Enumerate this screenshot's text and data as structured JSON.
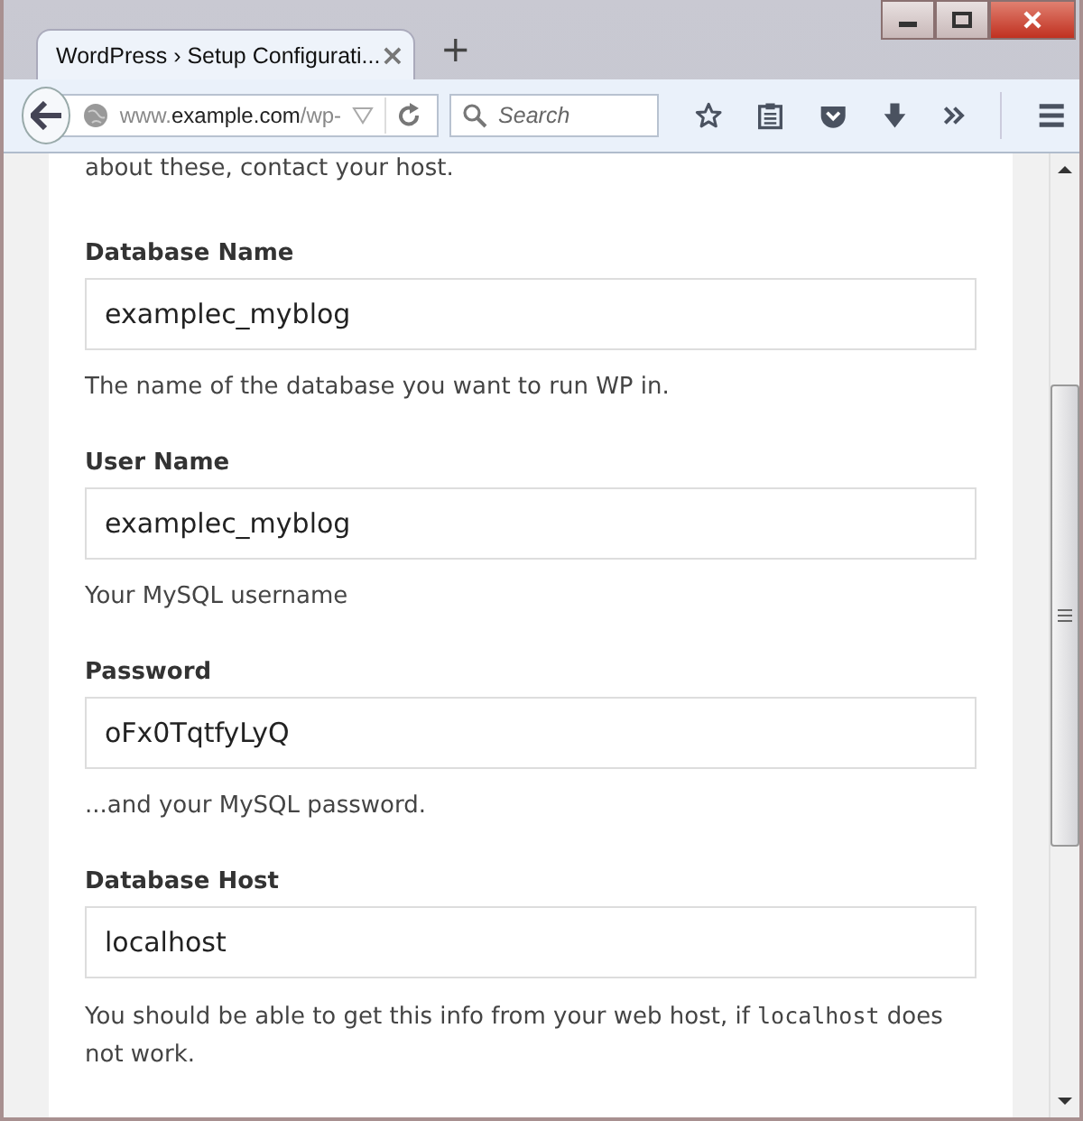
{
  "tab": {
    "title": "WordPress › Setup Configurati...",
    "close": "×"
  },
  "new_tab": "+",
  "address": {
    "prefix": "www.",
    "domain": "example.com",
    "path": "/wp-"
  },
  "search": {
    "placeholder": "Search"
  },
  "intro": "about these, contact your host.",
  "fields": [
    {
      "label": "Database Name",
      "value": "examplec_myblog",
      "help": [
        {
          "kind": "text",
          "text": "The name of the database you want to run WP in."
        }
      ]
    },
    {
      "label": "User Name",
      "value": "examplec_myblog",
      "help": [
        {
          "kind": "text",
          "text": "Your MySQL username"
        }
      ]
    },
    {
      "label": "Password",
      "value": "oFx0TqtfyLyQ",
      "help": [
        {
          "kind": "text",
          "text": "...and your MySQL password."
        }
      ]
    },
    {
      "label": "Database Host",
      "value": "localhost",
      "help": [
        {
          "kind": "text",
          "text": "You should be able to get this info from your web host, if "
        },
        {
          "kind": "code",
          "text": "localhost"
        },
        {
          "kind": "text",
          "text": " does not work."
        }
      ]
    }
  ]
}
